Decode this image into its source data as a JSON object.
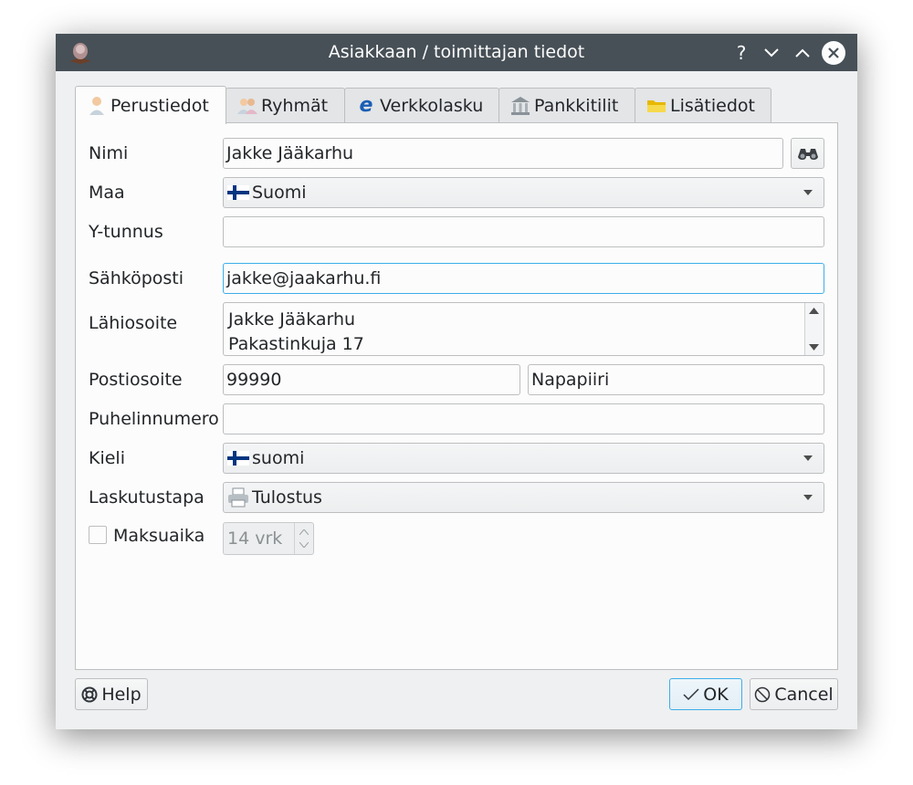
{
  "window": {
    "title": "Asiakkaan / toimittajan tiedot",
    "help_glyph": "?",
    "min_glyph": "⌄",
    "max_glyph": "⌃"
  },
  "tabs": [
    {
      "label": "Perustiedot",
      "icon": "person-icon",
      "active": true
    },
    {
      "label": "Ryhmät",
      "icon": "people-icon",
      "active": false
    },
    {
      "label": "Verkkolasku",
      "icon": "e-invoice-icon",
      "active": false
    },
    {
      "label": "Pankkitilit",
      "icon": "bank-icon",
      "active": false
    },
    {
      "label": "Lisätiedot",
      "icon": "folder-icon",
      "active": false
    }
  ],
  "form": {
    "name_label": "Nimi",
    "name_value": "Jakke Jääkarhu",
    "country_label": "Maa",
    "country_value": "Suomi",
    "business_id_label": "Y-tunnus",
    "business_id_value": "",
    "email_label": "Sähköposti",
    "email_value": "jakke@jaakarhu.fi",
    "address_label": "Lähiosoite",
    "address_line1": "Jakke Jääkarhu",
    "address_line2": "Pakastinkuja 17",
    "postal_label": "Postiosoite",
    "postal_code": "99990",
    "postal_city": "Napapiiri",
    "phone_label": "Puhelinnumero",
    "phone_value": "",
    "language_label": "Kieli",
    "language_value": "suomi",
    "billing_label": "Laskutustapa",
    "billing_value": "Tulostus",
    "payment_term_label": "Maksuaika",
    "payment_term_checked": false,
    "payment_term_value": "14 vrk"
  },
  "footer": {
    "help_label": "Help",
    "ok_label": "OK",
    "cancel_label": "Cancel"
  },
  "colors": {
    "titlebar": "#475057",
    "window_bg": "#eff0f1",
    "focus": "#3daee9",
    "flag_blue": "#003580"
  }
}
